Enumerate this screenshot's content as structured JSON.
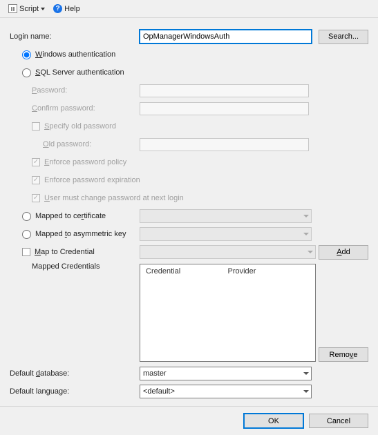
{
  "toolbar": {
    "script_label": "Script",
    "help_label": "Help"
  },
  "labels": {
    "login_name": "Login name:",
    "search_btn": "Search...",
    "win_auth_pre": "W",
    "win_auth_post": "indows authentication",
    "sql_auth_pre": "S",
    "sql_auth_post": "QL Server authentication",
    "password_pre": "P",
    "password_post": "assword:",
    "confirm_pre": "C",
    "confirm_post": "onfirm password:",
    "specify_pre": "S",
    "specify_post": "pecify old password",
    "old_pre": "O",
    "old_post": "ld password:",
    "enforce_policy_pre": "E",
    "enforce_policy_post": "nforce password policy",
    "enforce_exp": "Enforce password expiration",
    "user_must_pre": "U",
    "user_must_post": "ser must change password at next login",
    "mapped_cert_pre": "Mapped to ce",
    "mapped_cert_u": "r",
    "mapped_cert_post": "tificate",
    "mapped_key_pre": "Mapped ",
    "mapped_key_u": "t",
    "mapped_key_post": "o asymmetric key",
    "map_cred_pre": "",
    "map_cred_u": "M",
    "map_cred_post": "ap to Credential",
    "add_btn_pre": "",
    "add_btn_u": "A",
    "add_btn_post": "dd",
    "mapped_credentials": "Mapped Credentials",
    "col_credential": "Credential",
    "col_provider": "Provider",
    "remove_pre": "Remo",
    "remove_u": "v",
    "remove_post": "e",
    "default_db_pre": "Default ",
    "default_db_u": "d",
    "default_db_post": "atabase:",
    "default_lang_pre": "Default lan",
    "default_lang_u": "g",
    "default_lang_post": "uage:",
    "ok": "OK",
    "cancel": "Cancel"
  },
  "values": {
    "login_name": "OpManagerWindowsAuth",
    "default_database": "master",
    "default_language": "<default>"
  }
}
